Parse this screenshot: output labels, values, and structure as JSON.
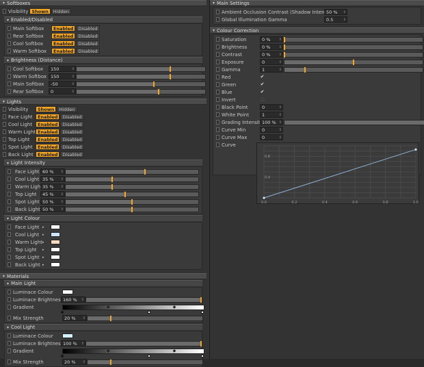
{
  "left": {
    "softboxes": {
      "title": "Softboxes",
      "visibility": {
        "label": "Visibility",
        "on": "Shown",
        "off": "Hidden"
      },
      "enabled_title": "Enabled/Disabled",
      "toggles": [
        {
          "label": "Main Softbox",
          "on": "Enabled",
          "off": "Disabled"
        },
        {
          "label": "Rear Softbox",
          "on": "Enabled",
          "off": "Disabled"
        },
        {
          "label": "Cool Softbox",
          "on": "Enabled",
          "off": "Disabled"
        },
        {
          "label": "Warm Softbox",
          "on": "Enabled",
          "off": "Disabled"
        }
      ],
      "bright_title": "Brightness (Distance)",
      "sliders": [
        {
          "label": "Cool Softbox",
          "value": "150",
          "level": 0.73
        },
        {
          "label": "Warm Softbox",
          "value": "150",
          "level": 0.73
        },
        {
          "label": "Main Softbox",
          "value": "-50",
          "level": 0.6
        },
        {
          "label": "Rear Softbox",
          "value": "0",
          "level": 0.64
        }
      ]
    },
    "lights": {
      "title": "Lights",
      "visibility": {
        "label": "Visibility",
        "on": "Shown",
        "off": "Hidden"
      },
      "toggles": [
        {
          "label": "Face Light",
          "on": "Enabled",
          "off": "Disabled"
        },
        {
          "label": "Cool Light",
          "on": "Enabled",
          "off": "Disabled"
        },
        {
          "label": "Warm Light",
          "on": "Enabled",
          "off": "Disabled"
        },
        {
          "label": "Top Light",
          "on": "Enabled",
          "off": "Disabled"
        },
        {
          "label": "Spot Light",
          "on": "Enabled",
          "off": "Disabled"
        },
        {
          "label": "Back Light",
          "on": "Enabled",
          "off": "Disabled"
        }
      ],
      "intensity_title": "Light Intensity",
      "intensity": [
        {
          "label": "Face Light",
          "value": "60 %",
          "level": 0.6
        },
        {
          "label": "Cool Light",
          "value": "35 %",
          "level": 0.35
        },
        {
          "label": "Warm Light",
          "value": "35 %",
          "level": 0.35
        },
        {
          "label": "Top Light",
          "value": "45 %",
          "level": 0.45
        },
        {
          "label": "Spot Light",
          "value": "50 %",
          "level": 0.5
        },
        {
          "label": "Back Light",
          "value": "50 %",
          "level": 0.5
        }
      ],
      "colour_title": "Light Colour",
      "colours": [
        {
          "label": "Face Light",
          "color": "#ffffff"
        },
        {
          "label": "Cool Light",
          "color": "#cde6f7"
        },
        {
          "label": "Warm Light",
          "color": "#f9d9bf"
        },
        {
          "label": "Top Light",
          "color": "#ffffff"
        },
        {
          "label": "Spot Light",
          "color": "#ffffff"
        },
        {
          "label": "Back Light",
          "color": "#ffffff"
        }
      ]
    },
    "materials": {
      "title": "Materials",
      "main": {
        "title": "Main Light",
        "lum_colour_label": "Luminace Colour",
        "lum_colour": "#ffffff",
        "lum_bright_label": "Luminace Brightness",
        "lum_bright_value": "160 %",
        "lum_bright_level": 1.0,
        "gradient_label": "Gradient",
        "mix_label": "Mix Strength",
        "mix_value": "20 %",
        "mix_level": 0.2
      },
      "cool": {
        "title": "Cool Light",
        "lum_colour_label": "Luminace Colour",
        "lum_colour": "#d3f1fb",
        "lum_bright_label": "Luminace Brightness",
        "lum_bright_value": "100 %",
        "lum_bright_level": 1.0,
        "gradient_label": "Gradient",
        "mix_label": "Mix Strength",
        "mix_value": "20 %",
        "mix_level": 0.2
      }
    }
  },
  "right": {
    "main_settings": {
      "title": "Main Settings",
      "ao_label": "Ambient Occlusion Contrast (Shadow Intensity)",
      "ao_value": "50 %",
      "gi_label": "Global Illumination Gamma",
      "gi_value": "0.5"
    },
    "colour_correction": {
      "title": "Colour Correction",
      "sliders": [
        {
          "label": "Saturation",
          "value": "0 %",
          "level": 0.0
        },
        {
          "label": "Brightness",
          "value": "0 %",
          "level": 0.0
        },
        {
          "label": "Contrast",
          "value": "0 %",
          "level": 0.0
        },
        {
          "label": "Exposure",
          "value": "0",
          "level": 0.5
        },
        {
          "label": "Gamma",
          "value": "1",
          "level": 0.15
        }
      ],
      "checks": [
        {
          "label": "Red",
          "checked": true
        },
        {
          "label": "Green",
          "checked": true
        },
        {
          "label": "Blue",
          "checked": true
        },
        {
          "label": "Invert",
          "checked": false
        }
      ],
      "points": [
        {
          "label": "Black Point",
          "value": "0"
        },
        {
          "label": "White Point",
          "value": "1"
        }
      ],
      "grading": {
        "label": "Grading Intensity",
        "value": "100 %",
        "level": 1.0
      },
      "curve_min": {
        "label": "Curve Min",
        "value": "0"
      },
      "curve_max": {
        "label": "Curve Max",
        "value": "0"
      },
      "curve_label": "Curve"
    }
  },
  "chart_data": {
    "type": "line",
    "x": [
      0.0,
      1.0
    ],
    "y": [
      0.0,
      0.93
    ],
    "xticks": [
      "0.0",
      "0.2",
      "0.4",
      "0.6",
      "0.8",
      "1.0"
    ],
    "yticks": [
      "0.4",
      "0.8"
    ],
    "xlim": [
      0,
      1
    ],
    "ylim": [
      0,
      1
    ]
  }
}
